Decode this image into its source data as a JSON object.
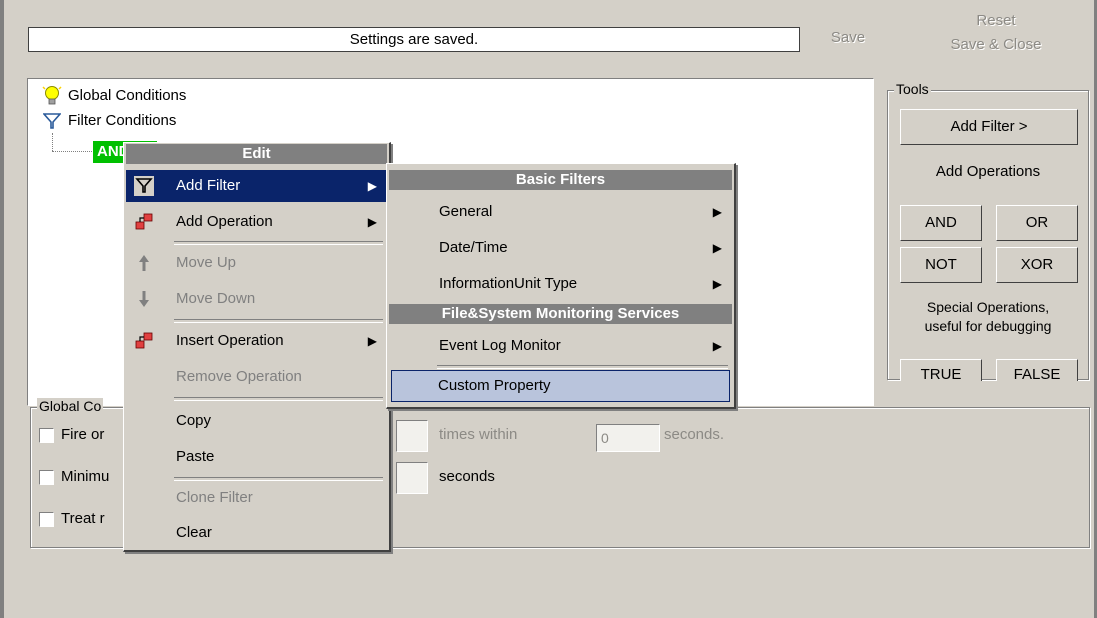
{
  "window": {
    "status_message": "Settings are saved.",
    "save_label": "Save",
    "reset_label": "Reset",
    "save_close_label": "Save & Close"
  },
  "tree": {
    "items": [
      {
        "label": "Global Conditions",
        "icon": "lightbulb-icon"
      },
      {
        "label": "Filter Conditions",
        "icon": "funnel-icon"
      },
      {
        "label": "AND",
        "icon": ""
      }
    ]
  },
  "tools": {
    "group_label": "Tools",
    "add_filter_label": "Add Filter >",
    "add_operations_label": "Add Operations",
    "and_label": "AND",
    "or_label": "OR",
    "not_label": "NOT",
    "xor_label": "XOR",
    "special_line1": "Special Operations,",
    "special_line2": "useful for debugging",
    "true_label": "TRUE",
    "false_label": "FALSE"
  },
  "global_conditions": {
    "group_label": "Global Co",
    "fire_label": "Fire or",
    "minimum_label": "Minimu",
    "treat_label": "Treat r",
    "times_within_label": "times within",
    "times_within_value": "0",
    "seconds_label": "seconds.",
    "seconds2_label": "seconds"
  },
  "context_menu": {
    "header": "Edit",
    "items": [
      {
        "label": "Add Filter",
        "icon": "funnel-icon",
        "submenu": true,
        "selected": true,
        "disabled": false
      },
      {
        "label": "Add Operation",
        "icon": "operation-icon",
        "submenu": true,
        "selected": false,
        "disabled": false
      },
      {
        "label": "Move Up",
        "icon": "arrow-up-icon",
        "submenu": false,
        "selected": false,
        "disabled": true
      },
      {
        "label": "Move Down",
        "icon": "arrow-down-icon",
        "submenu": false,
        "selected": false,
        "disabled": true
      },
      {
        "label": "Insert Operation",
        "icon": "operation-icon",
        "submenu": true,
        "selected": false,
        "disabled": false
      },
      {
        "label": "Remove Operation",
        "icon": "",
        "submenu": false,
        "selected": false,
        "disabled": true
      },
      {
        "label": "Copy",
        "icon": "",
        "submenu": false,
        "selected": false,
        "disabled": false
      },
      {
        "label": "Paste",
        "icon": "",
        "submenu": false,
        "selected": false,
        "disabled": false
      },
      {
        "label": "Clone Filter",
        "icon": "",
        "submenu": false,
        "selected": false,
        "disabled": true
      },
      {
        "label": "Clear",
        "icon": "",
        "submenu": false,
        "selected": false,
        "disabled": false
      }
    ]
  },
  "submenu": {
    "header1": "Basic Filters",
    "general": "General",
    "datetime": "Date/Time",
    "info_unit_type": "InformationUnit Type",
    "header2": "File&System Monitoring Services",
    "event_log": "Event Log Monitor",
    "custom_property": "Custom Property"
  },
  "colors": {
    "background": "#d4d0c8",
    "menu_selection": "#0a246a",
    "and_node": "#00c000",
    "header_bar": "#808080"
  }
}
